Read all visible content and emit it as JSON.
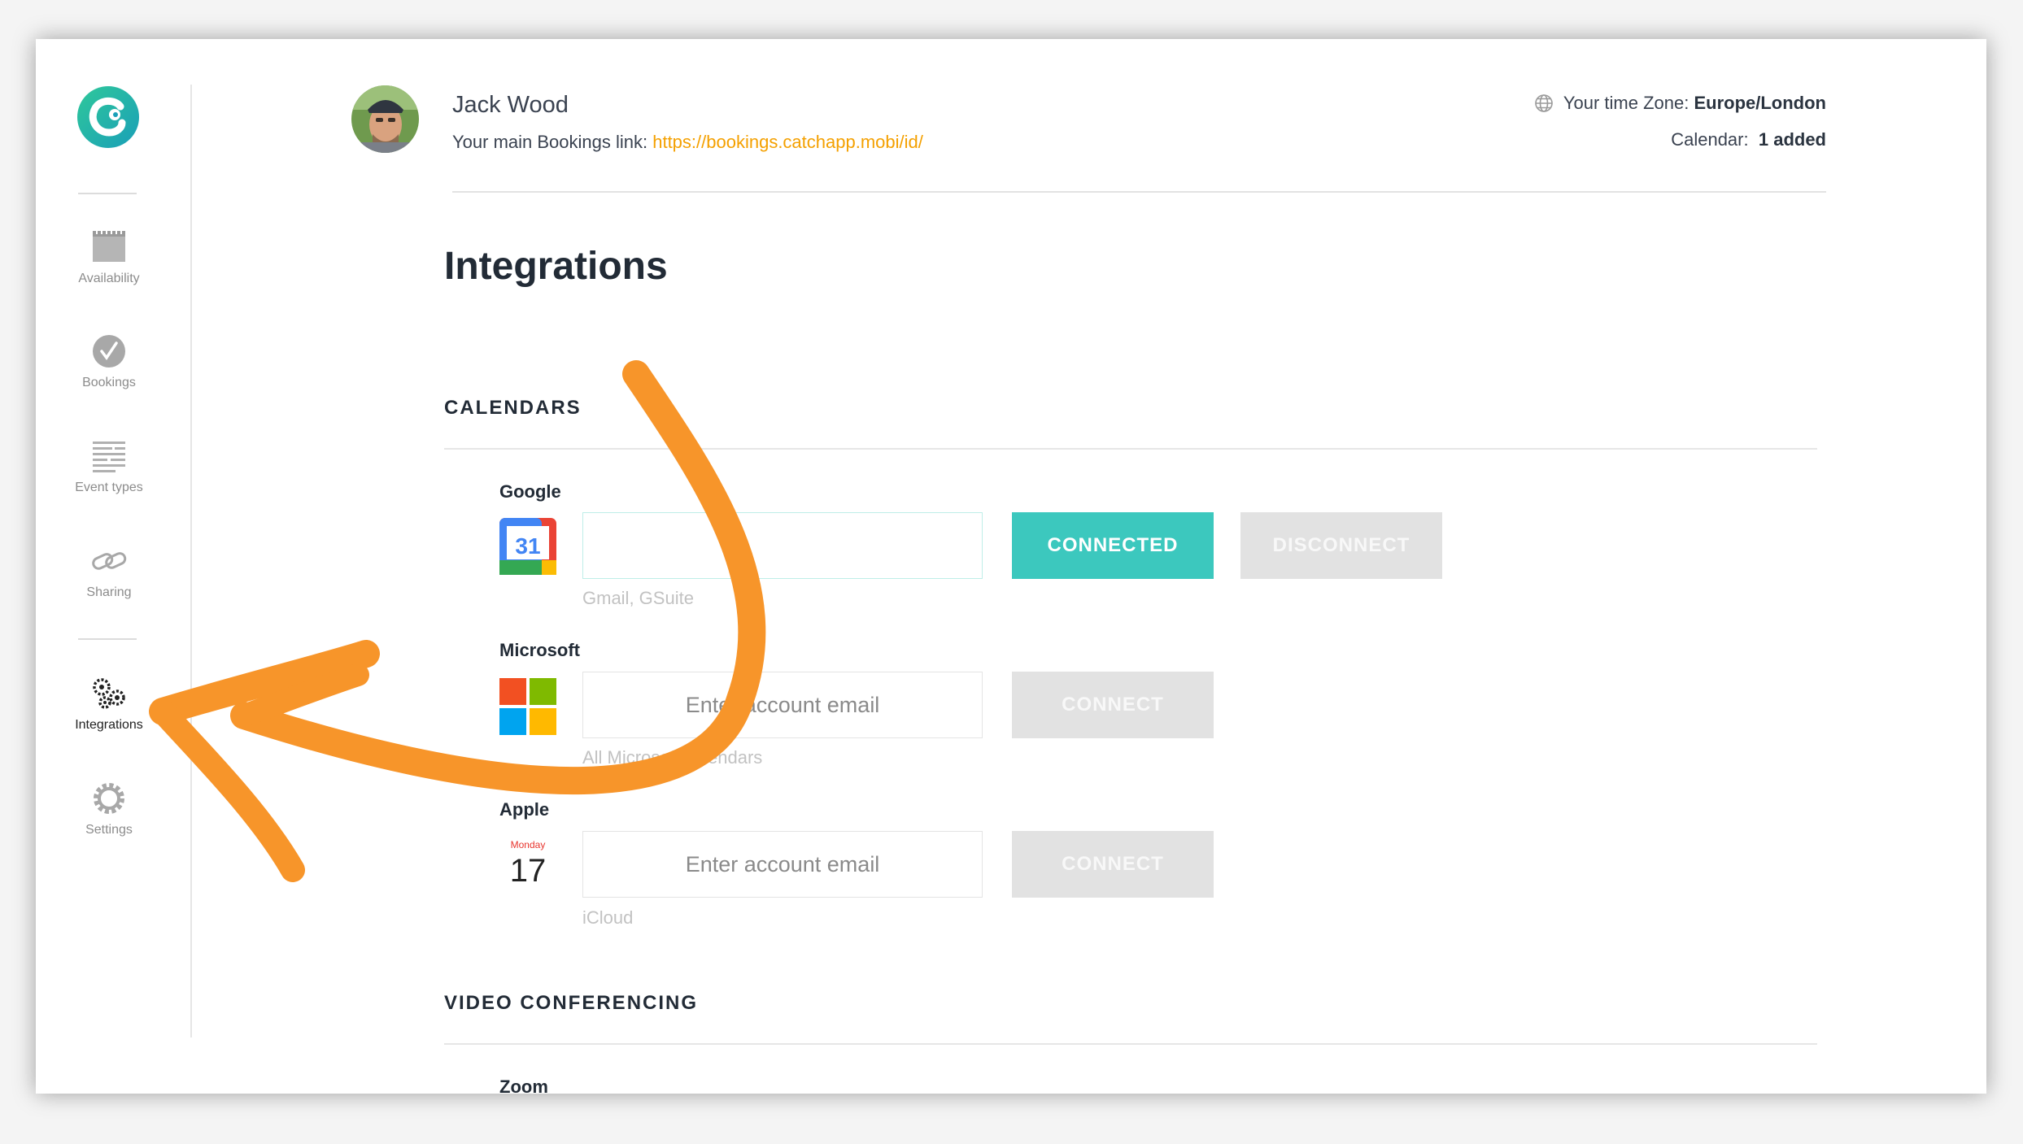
{
  "sidebar": {
    "items": [
      {
        "label": "Availability",
        "icon": "calendar-icon"
      },
      {
        "label": "Bookings",
        "icon": "check-circle-icon"
      },
      {
        "label": "Event types",
        "icon": "list-icon"
      },
      {
        "label": "Sharing",
        "icon": "link-icon"
      },
      {
        "label": "Integrations",
        "icon": "gears-icon",
        "active": true
      },
      {
        "label": "Settings",
        "icon": "gear-icon"
      }
    ]
  },
  "header": {
    "user_name": "Jack Wood",
    "booking_label": "Your main Bookings link: ",
    "booking_link": "https://bookings.catchapp.mobi/id/",
    "tz_label": "Your time Zone: ",
    "tz_value": "Europe/London",
    "calendar_label": "Calendar: ",
    "calendar_value": "1 added"
  },
  "page_title": "Integrations",
  "calendars": {
    "title": "CALENDARS",
    "providers": [
      {
        "name": "Google",
        "input_value": "",
        "placeholder": "",
        "hint": "Gmail, GSuite",
        "primary_label": "CONNECTED",
        "secondary_label": "DISCONNECT",
        "icon_text": "31"
      },
      {
        "name": "Microsoft",
        "input_value": "",
        "placeholder": "Enter account email",
        "hint": "All Microsoft calendars",
        "primary_label": "CONNECT"
      },
      {
        "name": "Apple",
        "input_value": "",
        "placeholder": "Enter account email",
        "hint": "iCloud",
        "primary_label": "CONNECT",
        "icon_day": "Monday",
        "icon_date": "17"
      }
    ]
  },
  "video": {
    "title": "VIDEO CONFERENCING",
    "providers": [
      {
        "name": "Zoom"
      }
    ]
  },
  "colors": {
    "accent_teal": "#3cc8be",
    "link_orange": "#f4a000",
    "annotation_orange": "#f7952a",
    "button_disabled": "#e2e2e2"
  }
}
